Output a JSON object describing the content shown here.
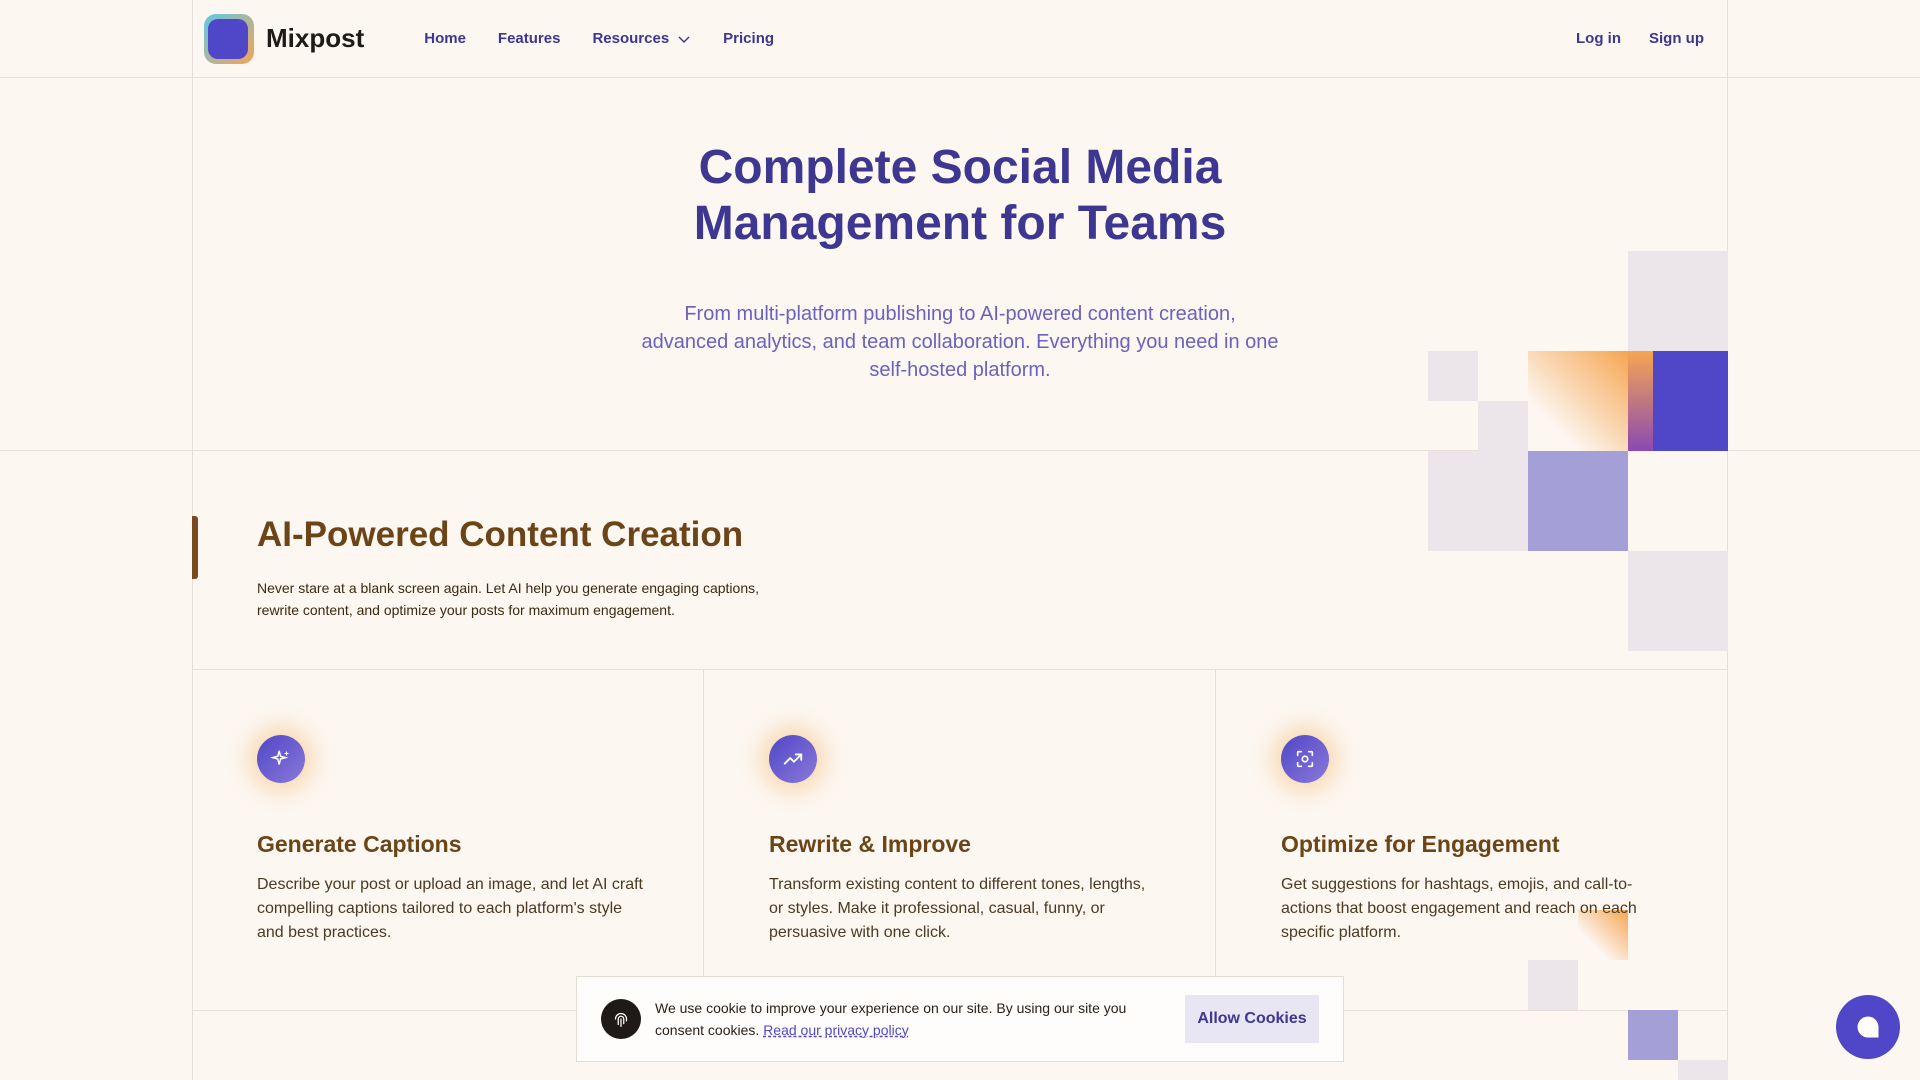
{
  "brand": {
    "name": "Mixpost"
  },
  "nav": {
    "items": [
      {
        "label": "Home"
      },
      {
        "label": "Features"
      },
      {
        "label": "Resources"
      },
      {
        "label": "Pricing"
      }
    ],
    "login": "Log in",
    "signup": "Sign up"
  },
  "hero": {
    "title_line1": "Complete Social Media",
    "title_line2": "Management for Teams",
    "subtitle": "From multi-platform publishing to AI-powered content creation, advanced analytics, and team collaboration. Everything you need in one self-hosted platform."
  },
  "section": {
    "title": "AI-Powered Content Creation",
    "description": "Never stare at a blank screen again. Let AI help you generate engaging captions, rewrite content, and optimize your posts for maximum engagement."
  },
  "cards": [
    {
      "icon": "sparkles-icon",
      "title": "Generate Captions",
      "description": "Describe your post or upload an image, and let AI craft compelling captions tailored to each platform's style and best practices."
    },
    {
      "icon": "trending-up-icon",
      "title": "Rewrite & Improve",
      "description": "Transform existing content to different tones, lengths, or styles. Make it professional, casual, funny, or persuasive with one click."
    },
    {
      "icon": "focus-icon",
      "title": "Optimize for Engagement",
      "description": "Get suggestions for hashtags, emojis, and call-to-actions that boost engagement and reach on each specific platform."
    }
  ],
  "cookie": {
    "text": "We use cookie to improve your experience on our site. By using our site you consent cookies.",
    "link": "Read our privacy policy",
    "button": "Allow Cookies"
  },
  "colors": {
    "background": "#fcf7f1",
    "accent": "#4f46c8",
    "heading": "#3e3791",
    "section_heading": "#6b4418",
    "highlight": "#f7a552"
  }
}
